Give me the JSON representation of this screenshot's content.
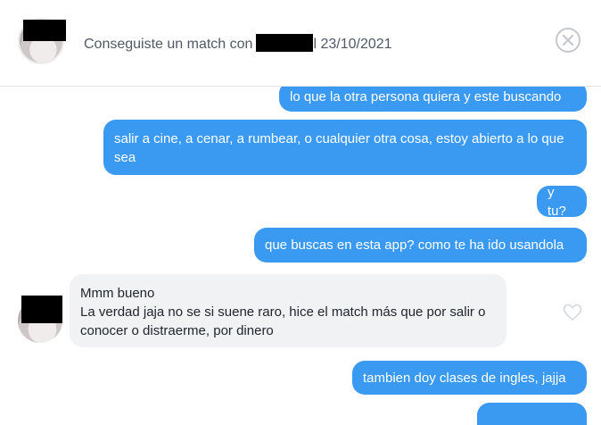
{
  "header": {
    "match_prefix": "Conseguiste un match con",
    "match_suffix": "l 23/10/2021",
    "close_icon": "close-circle-icon"
  },
  "messages": [
    {
      "side": "out",
      "text": "lo que la otra persona quiera y este buscando"
    },
    {
      "side": "out",
      "text": "salir a cine, a cenar, a rumbear, o cualquier otra cosa, estoy abierto a lo que sea"
    },
    {
      "side": "out",
      "text": "y tu?"
    },
    {
      "side": "out",
      "text": "que buscas en esta app? como te ha ido usandola"
    },
    {
      "side": "in",
      "line1": "Mmm bueno",
      "line2": "La verdad jaja no se si suene raro, hice el match más que por salir o conocer o distraerme, por dinero"
    },
    {
      "side": "out",
      "text": "tambien doy clases de ingles, jajja"
    }
  ],
  "icons": {
    "like": "heart-outline-icon",
    "close": "close-icon"
  },
  "colors": {
    "outgoing": "#3a99f0",
    "incoming": "#f0f2f4",
    "muted_text": "#505965"
  }
}
